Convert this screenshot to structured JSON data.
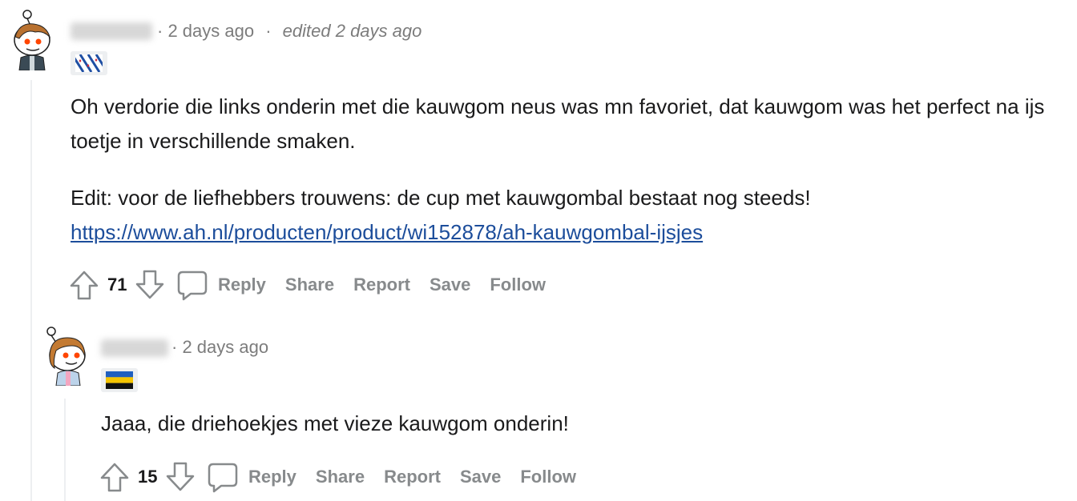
{
  "comments": [
    {
      "timestamp": "2 days ago",
      "edited": "edited 2 days ago",
      "flair_icon": "frisian-flag-icon",
      "paragraphs": [
        "Oh verdorie die links onderin met die kauwgom neus was mn favoriet, dat kauwgom was het perfect na ijs toetje in verschillende smaken.",
        "Edit: voor de liefhebbers trouwens: de cup met kauwgombal bestaat nog steeds!"
      ],
      "link": "https://www.ah.nl/producten/product/wi152878/ah-kauwgombal-ijsjes",
      "votes": "71",
      "actions": {
        "reply": "Reply",
        "share": "Share",
        "report": "Report",
        "save": "Save",
        "follow": "Follow"
      }
    },
    {
      "timestamp": "2 days ago",
      "flair_icon": "gelderland-flag-icon",
      "paragraphs": [
        "Jaaa, die driehoekjes met vieze kauwgom onderin!"
      ],
      "votes": "15",
      "actions": {
        "reply": "Reply",
        "share": "Share",
        "report": "Report",
        "save": "Save",
        "follow": "Follow"
      }
    }
  ],
  "colors": {
    "text": "#1a1a1b",
    "meta": "#7c7c7c",
    "action": "#878a8c",
    "link": "#1c4d9b",
    "thread": "#edeff1"
  }
}
